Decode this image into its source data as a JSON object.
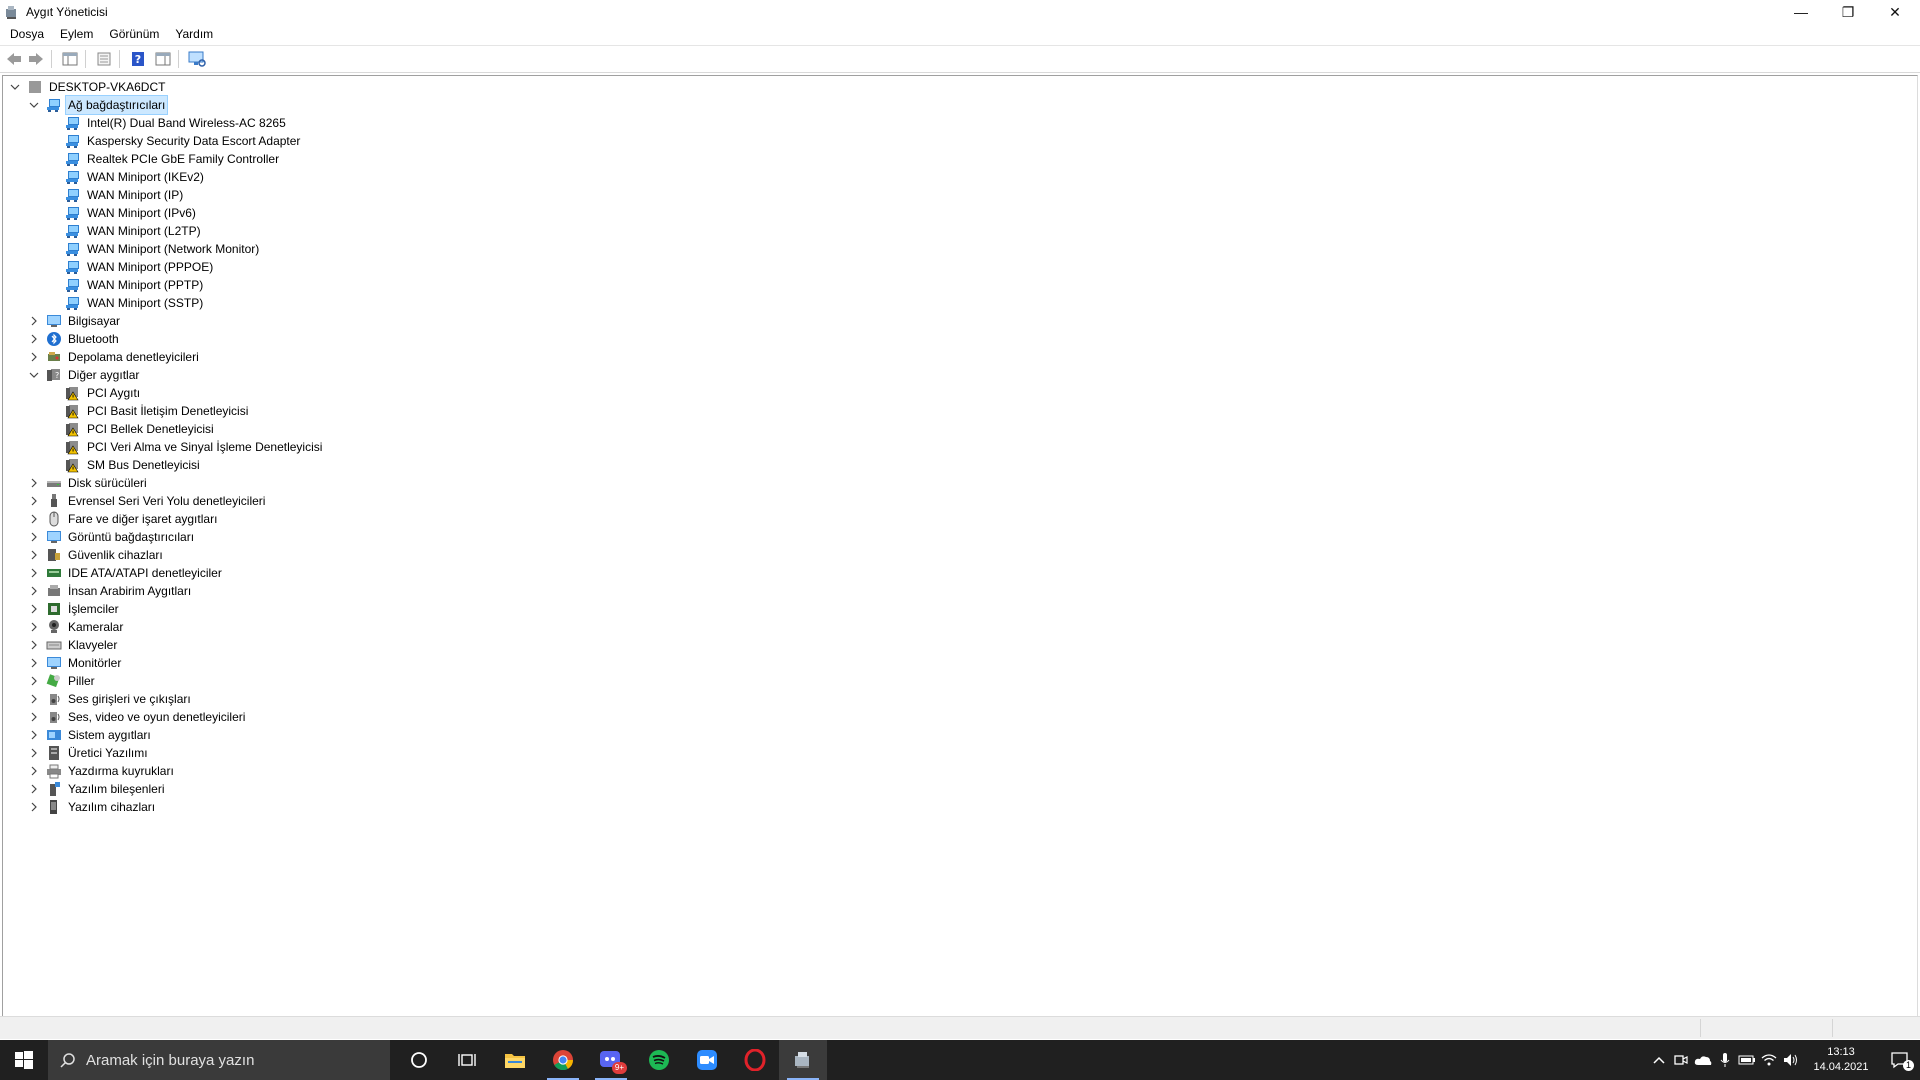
{
  "window": {
    "title": "Aygıt Yöneticisi",
    "minimize_glyph": "—",
    "restore_glyph": "❐",
    "close_glyph": "✕"
  },
  "menu": [
    "Dosya",
    "Eylem",
    "Görünüm",
    "Yardım"
  ],
  "toolbar_icons": [
    "back-arrow-icon",
    "forward-arrow-icon",
    "show-hide-console-tree-icon",
    "properties-icon",
    "help-icon",
    "action-pane-icon",
    "scan-hardware-icon"
  ],
  "tree": {
    "root": "DESKTOP-VKA6DCT",
    "categories": [
      {
        "label": "Ağ bağdaştırıcıları",
        "icon": "network-adapter-icon",
        "expanded": true,
        "selected": true,
        "children": [
          "Intel(R) Dual Band Wireless-AC 8265",
          "Kaspersky Security Data Escort Adapter",
          "Realtek PCIe GbE Family Controller",
          "WAN Miniport (IKEv2)",
          "WAN Miniport (IP)",
          "WAN Miniport (IPv6)",
          "WAN Miniport (L2TP)",
          "WAN Miniport (Network Monitor)",
          "WAN Miniport (PPPOE)",
          "WAN Miniport (PPTP)",
          "WAN Miniport (SSTP)"
        ],
        "child_icon": "network-adapter-icon"
      },
      {
        "label": "Bilgisayar",
        "icon": "computer-icon",
        "expanded": false
      },
      {
        "label": "Bluetooth",
        "icon": "bluetooth-icon",
        "expanded": false
      },
      {
        "label": "Depolama denetleyicileri",
        "icon": "storage-controller-icon",
        "expanded": false
      },
      {
        "label": "Diğer aygıtlar",
        "icon": "unknown-device-icon",
        "expanded": true,
        "children": [
          "PCI Aygıtı",
          "PCI Basit İletişim Denetleyicisi",
          "PCI Bellek Denetleyicisi",
          "PCI Veri Alma ve Sinyal İşleme Denetleyicisi",
          "SM Bus Denetleyicisi"
        ],
        "child_icon": "warning-device-icon"
      },
      {
        "label": "Disk sürücüleri",
        "icon": "disk-drive-icon",
        "expanded": false
      },
      {
        "label": "Evrensel Seri Veri Yolu denetleyicileri",
        "icon": "usb-icon",
        "expanded": false
      },
      {
        "label": "Fare ve diğer işaret aygıtları",
        "icon": "mouse-icon",
        "expanded": false
      },
      {
        "label": "Görüntü bağdaştırıcıları",
        "icon": "display-adapter-icon",
        "expanded": false
      },
      {
        "label": "Güvenlik cihazları",
        "icon": "security-device-icon",
        "expanded": false
      },
      {
        "label": "IDE ATA/ATAPI denetleyiciler",
        "icon": "ide-controller-icon",
        "expanded": false
      },
      {
        "label": "İnsan Arabirim Aygıtları",
        "icon": "hid-icon",
        "expanded": false
      },
      {
        "label": "İşlemciler",
        "icon": "processor-icon",
        "expanded": false
      },
      {
        "label": "Kameralar",
        "icon": "camera-icon",
        "expanded": false
      },
      {
        "label": "Klavyeler",
        "icon": "keyboard-icon",
        "expanded": false
      },
      {
        "label": "Monitörler",
        "icon": "monitor-icon",
        "expanded": false
      },
      {
        "label": "Piller",
        "icon": "battery-icon",
        "expanded": false
      },
      {
        "label": "Ses girişleri ve çıkışları",
        "icon": "speaker-icon",
        "expanded": false
      },
      {
        "label": "Ses, video ve oyun denetleyicileri",
        "icon": "sound-controller-icon",
        "expanded": false
      },
      {
        "label": "Sistem aygıtları",
        "icon": "system-device-icon",
        "expanded": false
      },
      {
        "label": "Üretici Yazılımı",
        "icon": "firmware-icon",
        "expanded": false
      },
      {
        "label": "Yazdırma kuyrukları",
        "icon": "printer-icon",
        "expanded": false
      },
      {
        "label": "Yazılım bileşenleri",
        "icon": "software-component-icon",
        "expanded": false
      },
      {
        "label": "Yazılım cihazları",
        "icon": "software-device-icon",
        "expanded": false
      }
    ]
  },
  "taskbar": {
    "search_placeholder": "Aramak için buraya yazın",
    "apps": [
      "cortana-icon",
      "task-view-icon",
      "file-explorer-icon",
      "chrome-icon",
      "game-app-icon",
      "spotify-icon",
      "zoom-icon",
      "opera-icon",
      "device-manager-icon"
    ],
    "game_badge": "9+",
    "time": "13:13",
    "date": "14.04.2021",
    "notification_count": "1"
  },
  "colors": {
    "selection": "#cce8ff",
    "taskbar": "#202020",
    "network_icon": "#2e7fd0",
    "warning": "#f2c200"
  }
}
